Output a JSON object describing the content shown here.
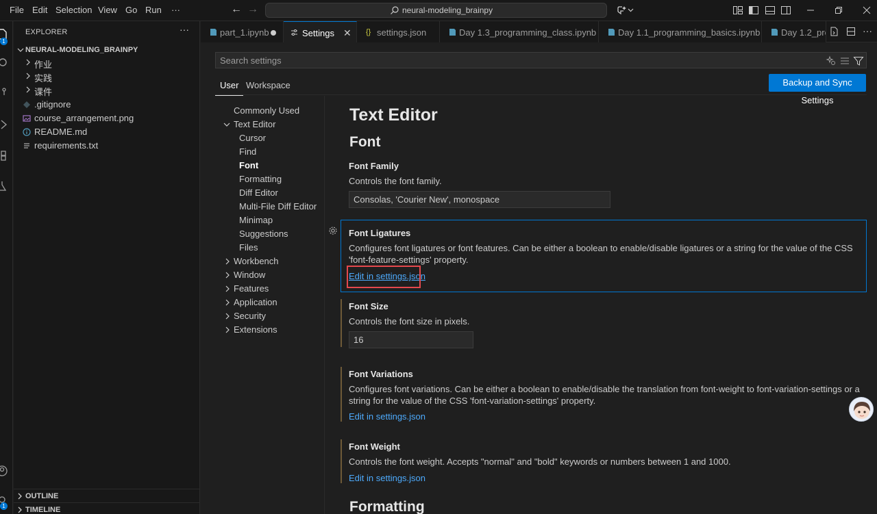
{
  "menu": [
    "File",
    "Edit",
    "Selection",
    "View",
    "Go",
    "Run"
  ],
  "menu_more": "···",
  "command_center": {
    "text": "neural-modeling_brainpy"
  },
  "explorer": {
    "title": "EXPLORER",
    "more": "···",
    "root": "NEURAL-MODELING_BRAINPY",
    "folders": [
      "作业",
      "实践",
      "课件"
    ],
    "files": [
      ".gitignore",
      "course_arrangement.png",
      "README.md",
      "requirements.txt"
    ],
    "sections": [
      "OUTLINE",
      "TIMELINE"
    ],
    "badges": [
      "1",
      "1"
    ]
  },
  "tabs": [
    {
      "label": "part_1.ipynb"
    },
    {
      "label": "Settings"
    },
    {
      "label": "settings.json"
    },
    {
      "label": "Day 1.3_programming_class.ipynb"
    },
    {
      "label": "Day 1.1_programming_basics.ipynb"
    },
    {
      "label": "Day 1.2_pro"
    }
  ],
  "settings": {
    "search_placeholder": "Search settings",
    "scopes": [
      "User",
      "Workspace"
    ],
    "sync_button": "Backup and Sync Settings",
    "toc": {
      "commonly_used": "Commonly Used",
      "text_editor": "Text Editor",
      "text_editor_children": [
        "Cursor",
        "Find",
        "Font",
        "Formatting",
        "Diff Editor",
        "Multi-File Diff Editor",
        "Minimap",
        "Suggestions",
        "Files"
      ],
      "collapsed": [
        "Workbench",
        "Window",
        "Features",
        "Application",
        "Security",
        "Extensions"
      ]
    },
    "section_title": "Text Editor",
    "subsection_title": "Font",
    "next_subsection_title": "Formatting",
    "items": [
      {
        "title": "Font Family",
        "description": "Controls the font family.",
        "value": "Consolas, 'Courier New', monospace"
      },
      {
        "title": "Font Ligatures",
        "description": "Configures font ligatures or font features. Can be either a boolean to enable/disable ligatures or a string for the value of the CSS 'font-feature-settings' property.",
        "link": "Edit in settings.json"
      },
      {
        "title": "Font Size",
        "description": "Controls the font size in pixels.",
        "value": "16"
      },
      {
        "title": "Font Variations",
        "description": "Configures font variations. Can be either a boolean to enable/disable the translation from font-weight to font-variation-settings or a string for the value of the CSS 'font-variation-settings' property.",
        "link": "Edit in settings.json"
      },
      {
        "title": "Font Weight",
        "description": "Controls the font weight. Accepts \"normal\" and \"bold\" keywords or numbers between 1 and 1000.",
        "link": "Edit in settings.json"
      }
    ]
  },
  "colors": {
    "accent": "#0078d4",
    "link": "#4daafc",
    "highlight": "#e5484d",
    "modified_bar": "#6e5a38"
  }
}
